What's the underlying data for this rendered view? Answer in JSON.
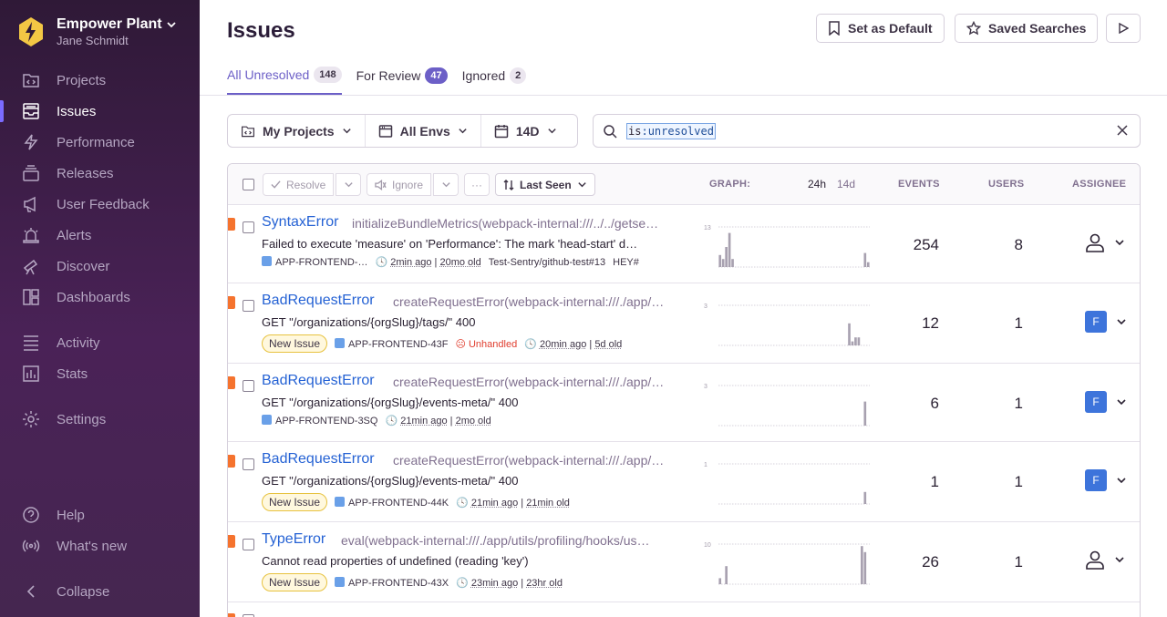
{
  "org": {
    "name": "Empower Plant",
    "user": "Jane Schmidt"
  },
  "nav": {
    "projects": "Projects",
    "issues": "Issues",
    "performance": "Performance",
    "releases": "Releases",
    "user_feedback": "User Feedback",
    "alerts": "Alerts",
    "discover": "Discover",
    "dashboards": "Dashboards",
    "activity": "Activity",
    "stats": "Stats",
    "settings": "Settings",
    "help": "Help",
    "whats_new": "What's new",
    "collapse": "Collapse"
  },
  "header": {
    "title": "Issues",
    "set_default": "Set as Default",
    "saved_searches": "Saved Searches"
  },
  "tabs": [
    {
      "label": "All Unresolved",
      "count": "148"
    },
    {
      "label": "For Review",
      "count": "47"
    },
    {
      "label": "Ignored",
      "count": "2"
    }
  ],
  "filters": {
    "projects": "My Projects",
    "envs": "All Envs",
    "period": "14D",
    "query_key": "is",
    "query_value": "unresolved"
  },
  "table": {
    "resolve": "Resolve",
    "ignore": "Ignore",
    "more": "···",
    "sort": "Last Seen",
    "graph": "GRAPH:",
    "p24h": "24h",
    "p14d": "14d",
    "events": "EVENTS",
    "users": "USERS",
    "assignee": "ASSIGNEE"
  },
  "issues": [
    {
      "type": "SyntaxError",
      "loc": "initializeBundleMetrics(webpack-internal:///../../getse…",
      "msg": "Failed to execute 'measure' on 'Performance': The mark 'head-start' d…",
      "project": "APP-FRONTEND-…",
      "last": "2min ago",
      "first": "20mo old",
      "extra1": "Test-Sentry/github-test#13",
      "extra2": "HEY#",
      "events": "254",
      "users": "8",
      "graph_max": "13",
      "bars": [
        0.3,
        0.2,
        0.5,
        0.85,
        0.2,
        0,
        0,
        0,
        0,
        0,
        0,
        0,
        0,
        0,
        0,
        0,
        0,
        0,
        0,
        0,
        0,
        0,
        0,
        0,
        0,
        0,
        0,
        0,
        0,
        0,
        0,
        0,
        0,
        0,
        0,
        0,
        0,
        0,
        0,
        0,
        0,
        0,
        0,
        0,
        0,
        0,
        0.35,
        0.12
      ]
    },
    {
      "type": "BadRequestError",
      "loc": "createRequestError(webpack-internal:///./app/…",
      "msg": "GET \"/organizations/{orgSlug}/tags/\" 400",
      "pill": "New Issue",
      "project": "APP-FRONTEND-43F",
      "unhandled": "Unhandled",
      "last": "20min ago",
      "first": "5d old",
      "events": "12",
      "users": "1",
      "avatar": "F",
      "graph_max": "3",
      "bars": [
        0,
        0,
        0,
        0,
        0,
        0,
        0,
        0,
        0,
        0,
        0,
        0,
        0,
        0,
        0,
        0,
        0,
        0,
        0,
        0,
        0,
        0,
        0,
        0,
        0,
        0,
        0,
        0,
        0,
        0,
        0,
        0,
        0,
        0,
        0,
        0,
        0,
        0,
        0,
        0,
        0,
        0.55,
        0.1,
        0.2,
        0.2,
        0,
        0,
        0
      ]
    },
    {
      "type": "BadRequestError",
      "loc": "createRequestError(webpack-internal:///./app/…",
      "msg": "GET \"/organizations/{orgSlug}/events-meta/\" 400",
      "project": "APP-FRONTEND-3SQ",
      "last": "21min ago",
      "first": "2mo old",
      "events": "6",
      "users": "1",
      "avatar": "F",
      "graph_max": "3",
      "bars": [
        0,
        0,
        0,
        0,
        0,
        0,
        0,
        0,
        0,
        0,
        0,
        0,
        0,
        0,
        0,
        0,
        0,
        0,
        0,
        0,
        0,
        0,
        0,
        0,
        0,
        0,
        0,
        0,
        0,
        0,
        0,
        0,
        0,
        0,
        0,
        0,
        0,
        0,
        0,
        0,
        0,
        0,
        0,
        0,
        0,
        0,
        0.6,
        0
      ]
    },
    {
      "type": "BadRequestError",
      "loc": "createRequestError(webpack-internal:///./app/…",
      "msg": "GET \"/organizations/{orgSlug}/events-meta/\" 400",
      "pill": "New Issue",
      "project": "APP-FRONTEND-44K",
      "last": "21min ago",
      "first": "21min old",
      "events": "1",
      "users": "1",
      "avatar": "F",
      "graph_max": "1",
      "bars": [
        0,
        0,
        0,
        0,
        0,
        0,
        0,
        0,
        0,
        0,
        0,
        0,
        0,
        0,
        0,
        0,
        0,
        0,
        0,
        0,
        0,
        0,
        0,
        0,
        0,
        0,
        0,
        0,
        0,
        0,
        0,
        0,
        0,
        0,
        0,
        0,
        0,
        0,
        0,
        0,
        0,
        0,
        0,
        0,
        0,
        0,
        0.3,
        0
      ]
    },
    {
      "type": "TypeError",
      "loc": "eval(webpack-internal:///./app/utils/profiling/hooks/us…",
      "msg": "Cannot read properties of undefined (reading 'key')",
      "pill": "New Issue",
      "project": "APP-FRONTEND-43X",
      "last": "23min ago",
      "first": "23hr old",
      "events": "26",
      "users": "1",
      "graph_max": "10",
      "bars": [
        0.15,
        0,
        0.45,
        0,
        0,
        0,
        0,
        0,
        0,
        0,
        0,
        0,
        0,
        0,
        0,
        0,
        0,
        0,
        0,
        0,
        0,
        0,
        0,
        0,
        0,
        0,
        0,
        0,
        0,
        0,
        0,
        0,
        0,
        0,
        0,
        0,
        0,
        0,
        0,
        0,
        0,
        0,
        0,
        0,
        0,
        0.95,
        0.8,
        0
      ]
    }
  ],
  "colors": {
    "sidebar_top": "#2f1937",
    "accent": "#6c5fc7",
    "link": "#2562d4",
    "level": "#f5732e"
  }
}
